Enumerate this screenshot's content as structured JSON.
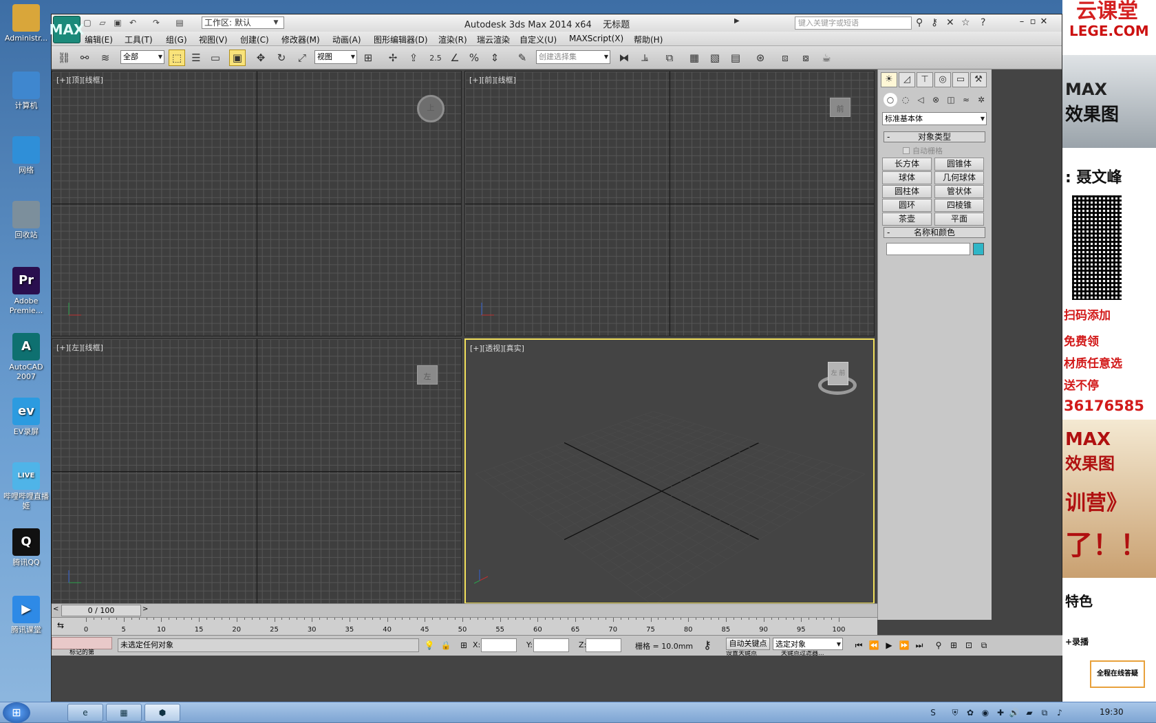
{
  "desktop_icons": [
    {
      "label": "Administr...",
      "icon": "folder-user-icon",
      "color": "#d9a63a"
    },
    {
      "label": "计算机",
      "icon": "computer-icon",
      "color": "#3f87cf"
    },
    {
      "label": "网络",
      "icon": "network-globe-icon",
      "color": "#2f8fd8"
    },
    {
      "label": "回收站",
      "icon": "recycle-bin-icon",
      "color": "#7c8f9c"
    },
    {
      "label": "Adobe Premie...",
      "icon": "premiere-icon",
      "color": "#2a0f4f",
      "glyph": "Pr"
    },
    {
      "label": "AutoCAD 2007",
      "icon": "autocad-icon",
      "color": "#0e7070",
      "glyph": "A"
    },
    {
      "label": "EV录屏",
      "icon": "ev-recorder-icon",
      "color": "#2c9be0",
      "glyph": "ev"
    },
    {
      "label": "哔哩哔哩直播姬",
      "icon": "bilibili-live-icon",
      "color": "#4fb4e8",
      "glyph": "LIVE"
    },
    {
      "label": "腾讯QQ",
      "icon": "qq-penguin-icon",
      "color": "#111111",
      "glyph": "Q"
    },
    {
      "label": "腾讯课堂",
      "icon": "tencent-classroom-icon",
      "color": "#2e8ae6",
      "glyph": "▶"
    }
  ],
  "app": {
    "title": "Autodesk 3ds Max  2014 x64",
    "doc": "无标题",
    "workspace": "工作区: 默认",
    "search_placeholder": "键入关键字或短语",
    "app_button": "MAX"
  },
  "menu": [
    "编辑(E)",
    "工具(T)",
    "组(G)",
    "视图(V)",
    "创建(C)",
    "修改器(M)",
    "动画(A)",
    "图形编辑器(D)",
    "渲染(R)",
    "瑞云渲染",
    "自定义(U)",
    "MAXScript(X)",
    "帮助(H)"
  ],
  "toolbar": {
    "filter": "全部",
    "ref_coord": "视图",
    "selection_set": "创建选择集",
    "snap_value": "2.5"
  },
  "viewports": {
    "top": {
      "label": "[+][顶][线框]",
      "cube": "上"
    },
    "front": {
      "label": "[+][前][线框]",
      "cube": "前"
    },
    "left": {
      "label": "[+][左][线框]",
      "cube": "左"
    },
    "persp": {
      "label": "[+][透视][真实]",
      "cube": "左 前"
    }
  },
  "cmd_panel": {
    "category": "标准基本体",
    "rollout_object_type": "对象类型",
    "autogrid": "自动栅格",
    "objects": [
      "长方体",
      "圆锥体",
      "球体",
      "几何球体",
      "圆柱体",
      "管状体",
      "圆环",
      "四棱锥",
      "茶壶",
      "平面"
    ],
    "rollout_name_color": "名称和颜色",
    "object_color": "#2fb6c7"
  },
  "timeline": {
    "frame": "0 / 100",
    "ticks": [
      "0",
      "5",
      "10",
      "15",
      "20",
      "25",
      "30",
      "35",
      "40",
      "45",
      "50",
      "55",
      "60",
      "65",
      "70",
      "75",
      "80",
      "85",
      "90",
      "95",
      "100"
    ]
  },
  "status": {
    "message": "未选定任何对象",
    "x_label": "X:",
    "y_label": "Y:",
    "z_label": "Z:",
    "grid": "栅格 = 10.0mm",
    "autokey": "自动关键点",
    "selected": "选定对象",
    "setkey": "设置关键点",
    "keyfilter": "关键点过滤器...",
    "mini": "标记的第"
  },
  "ad": {
    "brand_top": "云课堂",
    "brand_url": "LEGE.COM",
    "max_text": "MAX",
    "effect": "效果图",
    "teacher": ": 聂文峰",
    "scan": "扫码添加",
    "free": "免费领",
    "material": "材质任意选",
    "nonstop": "送不停",
    "phone": "36176585",
    "max2": "MAX",
    "effect2": "效果图",
    "camp": "训营》",
    "le": "了！！",
    "feature": "特色",
    "record": "+录播",
    "qa": "全程在线答疑"
  },
  "taskbar": {
    "clock": "19:30",
    "items": [
      "ie-icon",
      "green-app-icon",
      "3dsmax-icon"
    ]
  }
}
